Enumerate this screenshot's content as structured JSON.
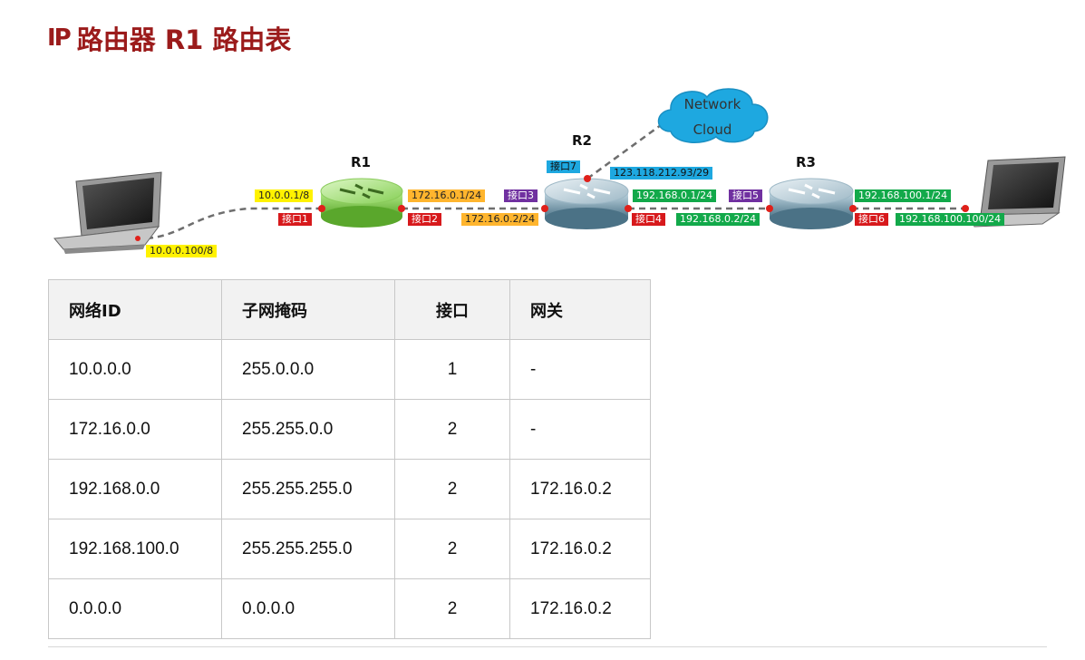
{
  "title": {
    "logo": "IP",
    "text": "路由器 R1 路由表"
  },
  "diagram": {
    "routers": {
      "r1": "R1",
      "r2": "R2",
      "r3": "R3"
    },
    "cloud": {
      "line1": "Network",
      "line2": "Cloud"
    },
    "labels": {
      "pc_left_ip": "10.0.0.100/8",
      "r1_if1_ip": "10.0.0.1/8",
      "r1_if1": "接口1",
      "r1_if2_ip": "172.16.0.1/24",
      "r1_if2": "接口2",
      "r2_if3": "接口3",
      "r2_if3_ip": "172.16.0.2/24",
      "r2_if7": "接口7",
      "r2_if7_ip": "123.118.212.93/29",
      "r2_if4_ip": "192.168.0.1/24",
      "r2_if4": "接口4",
      "r3_if5": "接口5",
      "r3_if5_ip": "192.168.0.2/24",
      "r3_if6_ip": "192.168.100.1/24",
      "r3_if6": "接口6",
      "pc_right_ip": "192.168.100.100/24"
    },
    "colors": {
      "r1_body": "#7fd14a",
      "r2_body": "#5e8fa6",
      "r3_body": "#5e8fa6",
      "port_dot": "#e0201a"
    }
  },
  "table": {
    "headers": [
      "网络ID",
      "子网掩码",
      "接口",
      "网关"
    ],
    "rows": [
      [
        "10.0.0.0",
        "255.0.0.0",
        "1",
        "-"
      ],
      [
        "172.16.0.0",
        "255.255.0.0",
        "2",
        "-"
      ],
      [
        "192.168.0.0",
        "255.255.255.0",
        "2",
        "172.16.0.2"
      ],
      [
        "192.168.100.0",
        "255.255.255.0",
        "2",
        "172.16.0.2"
      ],
      [
        "0.0.0.0",
        "0.0.0.0",
        "2",
        "172.16.0.2"
      ]
    ]
  }
}
